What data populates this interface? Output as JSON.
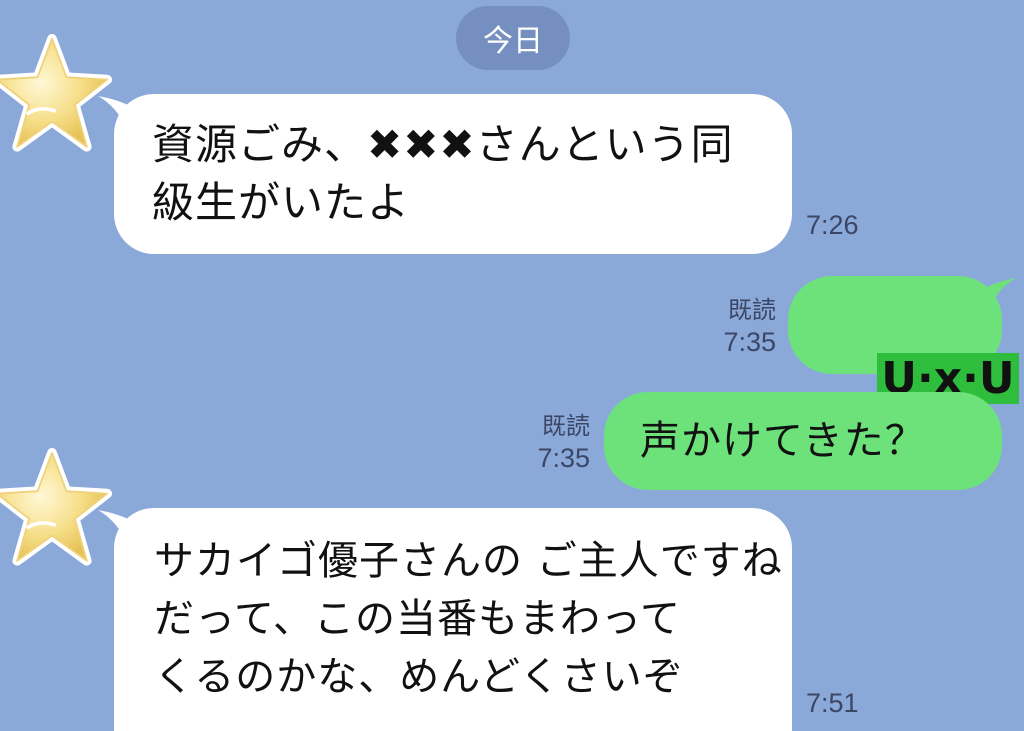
{
  "chat": {
    "date_label": "今日",
    "messages": [
      {
        "side": "in",
        "text": "資源ごみ、✖✖✖さんという同\n級生がいたよ",
        "time": "7:26"
      },
      {
        "side": "out",
        "read": "既読",
        "text": "U·x·U",
        "time": "7:35"
      },
      {
        "side": "out",
        "read": "既読",
        "text": "声かけてきた？",
        "time": "7:35"
      },
      {
        "side": "in",
        "text": "サカイゴ優子さんの ご主人ですね\nだって、この当番もまわって\nくるのかな、めんどくさいぞ",
        "time": "7:51"
      }
    ]
  },
  "colors": {
    "background": "#8aa9d9",
    "incoming_bubble": "#ffffff",
    "outgoing_bubble": "#6ee27a",
    "date_pill": "#7590c0"
  },
  "icons": {
    "avatar": "star-icon"
  }
}
